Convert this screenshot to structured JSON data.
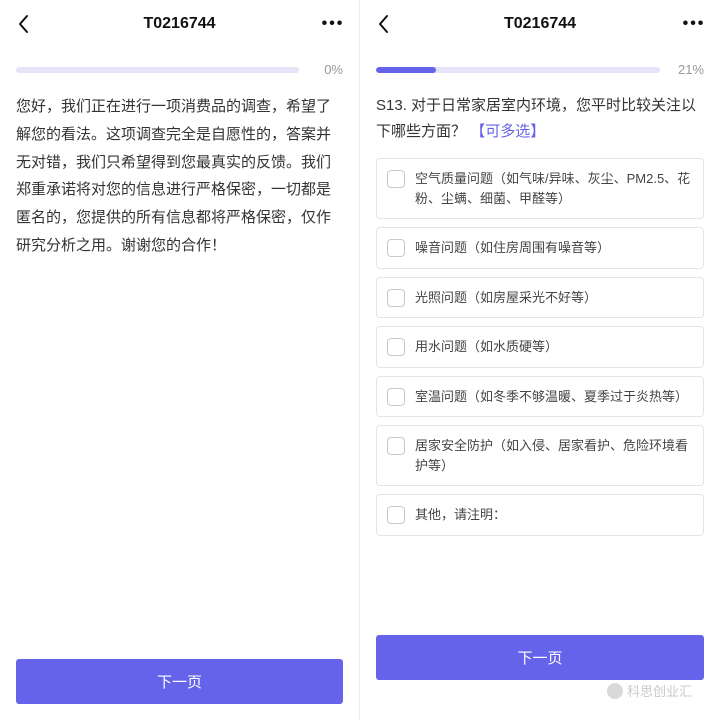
{
  "left": {
    "title": "T0216744",
    "progress": {
      "percent": 0,
      "label": "0%"
    },
    "intro": "您好，我们正在进行一项消费品的调查，希望了解您的看法。这项调查完全是自愿性的，答案并无对错，我们只希望得到您最真实的反馈。我们郑重承诺将对您的信息进行严格保密，一切都是匿名的，您提供的所有信息都将严格保密，仅作研究分析之用。谢谢您的合作！",
    "next_label": "下一页"
  },
  "right": {
    "title": "T0216744",
    "progress": {
      "percent": 21,
      "label": "21%"
    },
    "question_prefix": "S13. 对于日常家居室内环境，您平时比较关注以下哪些方面？",
    "question_tag": "【可多选】",
    "options": [
      "空气质量问题（如气味/异味、灰尘、PM2.5、花粉、尘螨、细菌、甲醛等）",
      "噪音问题（如住房周围有噪音等）",
      "光照问题（如房屋采光不好等）",
      "用水问题（如水质硬等）",
      "室温问题（如冬季不够温暖、夏季过于炎热等）",
      "居家安全防护（如入侵、居家看护、危险环境看护等）",
      "其他，请注明："
    ],
    "next_label": "下一页"
  },
  "watermark": "科思创业汇",
  "colors": {
    "accent": "#6563ea"
  }
}
